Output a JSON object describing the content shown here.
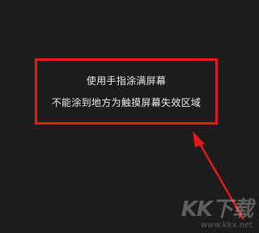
{
  "instructions": {
    "line1": "使用手指涂满屏幕",
    "line2": "不能涂到地方为触摸屏幕失效区域"
  },
  "watermark": {
    "logo": "KK下载",
    "url": "www.kkx.net"
  },
  "colors": {
    "background": "#1c1c1c",
    "highlight": "#e01b1b",
    "text": "#e9e9e9"
  }
}
